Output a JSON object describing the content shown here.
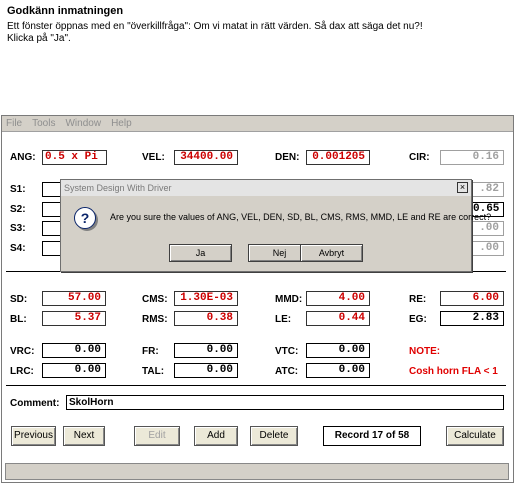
{
  "instruction": {
    "title": "Godkänn inmatningen",
    "line1": "Ett fönster öppnas med en \"överkillfråga\": Om vi matat in rätt värden. Så dax att säga det nu?!",
    "line2": "Klicka på \"Ja\"."
  },
  "menu": [
    "File",
    "Tools",
    "Window",
    "Help"
  ],
  "top_fields": {
    "ang": {
      "label": "ANG:",
      "value": "0.5 x Pi"
    },
    "vel": {
      "label": "VEL:",
      "value": "34400.00"
    },
    "den": {
      "label": "DEN:",
      "value": "0.001205"
    },
    "cir": {
      "label": "CIR:",
      "value": "0.16"
    }
  },
  "s_fields": [
    {
      "label": "S1:",
      "right": ".82"
    },
    {
      "label": "S2:",
      "right": "0.65"
    },
    {
      "label": "S3:",
      "right": ".00"
    },
    {
      "label": "S4:",
      "right": ".00"
    }
  ],
  "mid_fields": {
    "sd": {
      "label": "SD:",
      "value": "57.00"
    },
    "cms": {
      "label": "CMS:",
      "value": "1.30E-03"
    },
    "mmd": {
      "label": "MMD:",
      "value": "4.00"
    },
    "re": {
      "label": "RE:",
      "value": "6.00"
    },
    "bl": {
      "label": "BL:",
      "value": "5.37"
    },
    "rms": {
      "label": "RMS:",
      "value": "0.38"
    },
    "le": {
      "label": "LE:",
      "value": "0.44"
    },
    "eg": {
      "label": "EG:",
      "value": "2.83"
    }
  },
  "low_fields": {
    "vrc": {
      "label": "VRC:",
      "value": "0.00"
    },
    "fr": {
      "label": "FR:",
      "value": "0.00"
    },
    "vtc": {
      "label": "VTC:",
      "value": "0.00"
    },
    "lrc": {
      "label": "LRC:",
      "value": "0.00"
    },
    "tal": {
      "label": "TAL:",
      "value": "0.00"
    },
    "atc": {
      "label": "ATC:",
      "value": "0.00"
    }
  },
  "note": {
    "label": "NOTE:",
    "text": "Cosh horn  FLA < 1"
  },
  "comment": {
    "label": "Comment:",
    "value": "SkolHorn"
  },
  "buttons": {
    "previous": "Previous",
    "next": "Next",
    "edit": "Edit",
    "add": "Add",
    "delete": "Delete",
    "calculate": "Calculate"
  },
  "record_label": "Record 17 of 58",
  "dialog": {
    "title": "System Design With Driver",
    "close": "×",
    "message": "Are you sure the values of ANG, VEL, DEN, SD, BL, CMS, RMS, MMD, LE and RE are correct?",
    "yes": "Ja",
    "no": "Nej",
    "cancel": "Avbryt"
  },
  "colors": {
    "value_red": "#cc0000",
    "note_red": "#e00000",
    "disabled": "#a0a0a0",
    "window_bg": "#d4d0c8"
  }
}
